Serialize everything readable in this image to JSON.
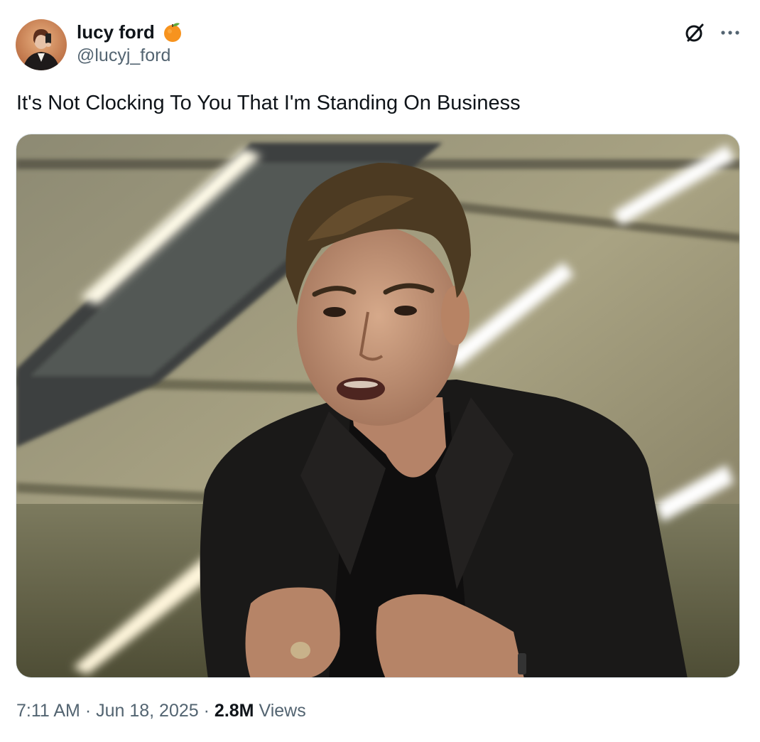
{
  "tweet": {
    "author": {
      "display_name": "lucy ford",
      "handle": "@lucyj_ford",
      "badge_icon": "orange-emoji",
      "avatar_icon": "profile-photo"
    },
    "text": "It's Not Clocking To You That I'm Standing On Business",
    "media": {
      "type": "photo",
      "description_icon": "movie-still-man-in-black-suit"
    },
    "meta": {
      "time": "7:11 AM",
      "separator": "·",
      "date": "Jun 18, 2025",
      "views_count": "2.8M",
      "views_label": "Views"
    },
    "actions": {
      "grok_icon": "grok-icon",
      "more_icon": "more-icon"
    }
  }
}
